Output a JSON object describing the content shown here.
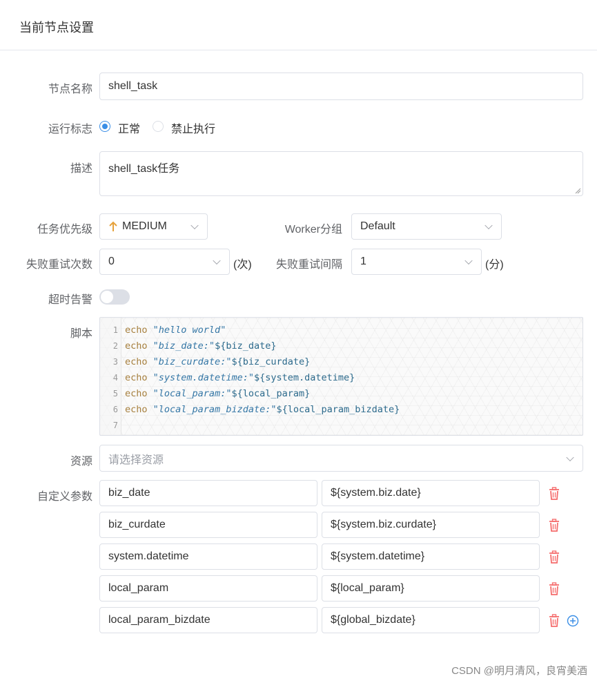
{
  "header": {
    "title": "当前节点设置"
  },
  "form": {
    "node_name": {
      "label": "节点名称",
      "value": "shell_task"
    },
    "run_flag": {
      "label": "运行标志",
      "options": [
        "正常",
        "禁止执行"
      ],
      "selected": "正常"
    },
    "description": {
      "label": "描述",
      "value": "shell_task任务"
    },
    "priority": {
      "label": "任务优先级",
      "value": "MEDIUM",
      "icon": "arrow-up-icon",
      "icon_color": "#e6a23c"
    },
    "worker_group": {
      "label": "Worker分组",
      "value": "Default"
    },
    "fail_retry_times": {
      "label": "失败重试次数",
      "value": "0",
      "unit": "(次)"
    },
    "fail_retry_interval": {
      "label": "失败重试间隔",
      "value": "1",
      "unit": "(分)"
    },
    "timeout_alert": {
      "label": "超时告警",
      "enabled": false
    },
    "script": {
      "label": "脚本",
      "lines": [
        {
          "num": "1",
          "kw": "echo",
          "str": "\"hello world\"",
          "var": ""
        },
        {
          "num": "2",
          "kw": "echo",
          "str": "\"biz_date:\"",
          "var": "${biz_date}"
        },
        {
          "num": "3",
          "kw": "echo",
          "str": "\"biz_curdate:\"",
          "var": "${biz_curdate}"
        },
        {
          "num": "4",
          "kw": "echo",
          "str": "\"system.datetime:\"",
          "var": "${system.datetime}"
        },
        {
          "num": "5",
          "kw": "echo",
          "str": "\"local_param:\"",
          "var": "${local_param}"
        },
        {
          "num": "6",
          "kw": "echo",
          "str": "\"local_param_bizdate:\"",
          "var": "${local_param_bizdate}"
        },
        {
          "num": "7",
          "kw": "",
          "str": "",
          "var": ""
        }
      ]
    },
    "resources": {
      "label": "资源",
      "placeholder": "请选择资源"
    },
    "custom_params": {
      "label": "自定义参数",
      "rows": [
        {
          "name": "biz_date",
          "value": "${system.biz.date}"
        },
        {
          "name": "biz_curdate",
          "value": "${system.biz.curdate}"
        },
        {
          "name": "system.datetime",
          "value": "${system.datetime}"
        },
        {
          "name": "local_param",
          "value": "${local_param}"
        },
        {
          "name": "local_param_bizdate",
          "value": "${global_bizdate}"
        }
      ]
    }
  },
  "colors": {
    "accent": "#3a8ee6",
    "danger": "#f56c6c",
    "priority": "#e6a23c"
  },
  "watermark": "CSDN @明月清风，良宵美酒"
}
